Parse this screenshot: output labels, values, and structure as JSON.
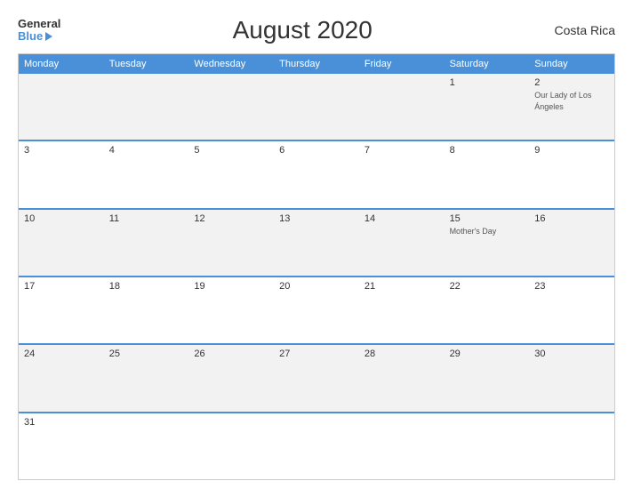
{
  "header": {
    "logo_general": "General",
    "logo_blue": "Blue",
    "title": "August 2020",
    "country": "Costa Rica"
  },
  "calendar": {
    "days": [
      "Monday",
      "Tuesday",
      "Wednesday",
      "Thursday",
      "Friday",
      "Saturday",
      "Sunday"
    ],
    "rows": [
      [
        {
          "num": "",
          "event": "",
          "empty": true
        },
        {
          "num": "",
          "event": "",
          "empty": true
        },
        {
          "num": "",
          "event": "",
          "empty": true
        },
        {
          "num": "",
          "event": "",
          "empty": true
        },
        {
          "num": "",
          "event": "",
          "empty": true
        },
        {
          "num": "1",
          "event": ""
        },
        {
          "num": "2",
          "event": "Our Lady of Los Ángeles"
        }
      ],
      [
        {
          "num": "3",
          "event": ""
        },
        {
          "num": "4",
          "event": ""
        },
        {
          "num": "5",
          "event": ""
        },
        {
          "num": "6",
          "event": ""
        },
        {
          "num": "7",
          "event": ""
        },
        {
          "num": "8",
          "event": ""
        },
        {
          "num": "9",
          "event": ""
        }
      ],
      [
        {
          "num": "10",
          "event": ""
        },
        {
          "num": "11",
          "event": ""
        },
        {
          "num": "12",
          "event": ""
        },
        {
          "num": "13",
          "event": ""
        },
        {
          "num": "14",
          "event": ""
        },
        {
          "num": "15",
          "event": "Mother's Day"
        },
        {
          "num": "16",
          "event": ""
        }
      ],
      [
        {
          "num": "17",
          "event": ""
        },
        {
          "num": "18",
          "event": ""
        },
        {
          "num": "19",
          "event": ""
        },
        {
          "num": "20",
          "event": ""
        },
        {
          "num": "21",
          "event": ""
        },
        {
          "num": "22",
          "event": ""
        },
        {
          "num": "23",
          "event": ""
        }
      ],
      [
        {
          "num": "24",
          "event": ""
        },
        {
          "num": "25",
          "event": ""
        },
        {
          "num": "26",
          "event": ""
        },
        {
          "num": "27",
          "event": ""
        },
        {
          "num": "28",
          "event": ""
        },
        {
          "num": "29",
          "event": ""
        },
        {
          "num": "30",
          "event": ""
        }
      ],
      [
        {
          "num": "31",
          "event": ""
        },
        {
          "num": "",
          "event": "",
          "empty": true
        },
        {
          "num": "",
          "event": "",
          "empty": true
        },
        {
          "num": "",
          "event": "",
          "empty": true
        },
        {
          "num": "",
          "event": "",
          "empty": true
        },
        {
          "num": "",
          "event": "",
          "empty": true
        },
        {
          "num": "",
          "event": "",
          "empty": true
        }
      ]
    ]
  }
}
